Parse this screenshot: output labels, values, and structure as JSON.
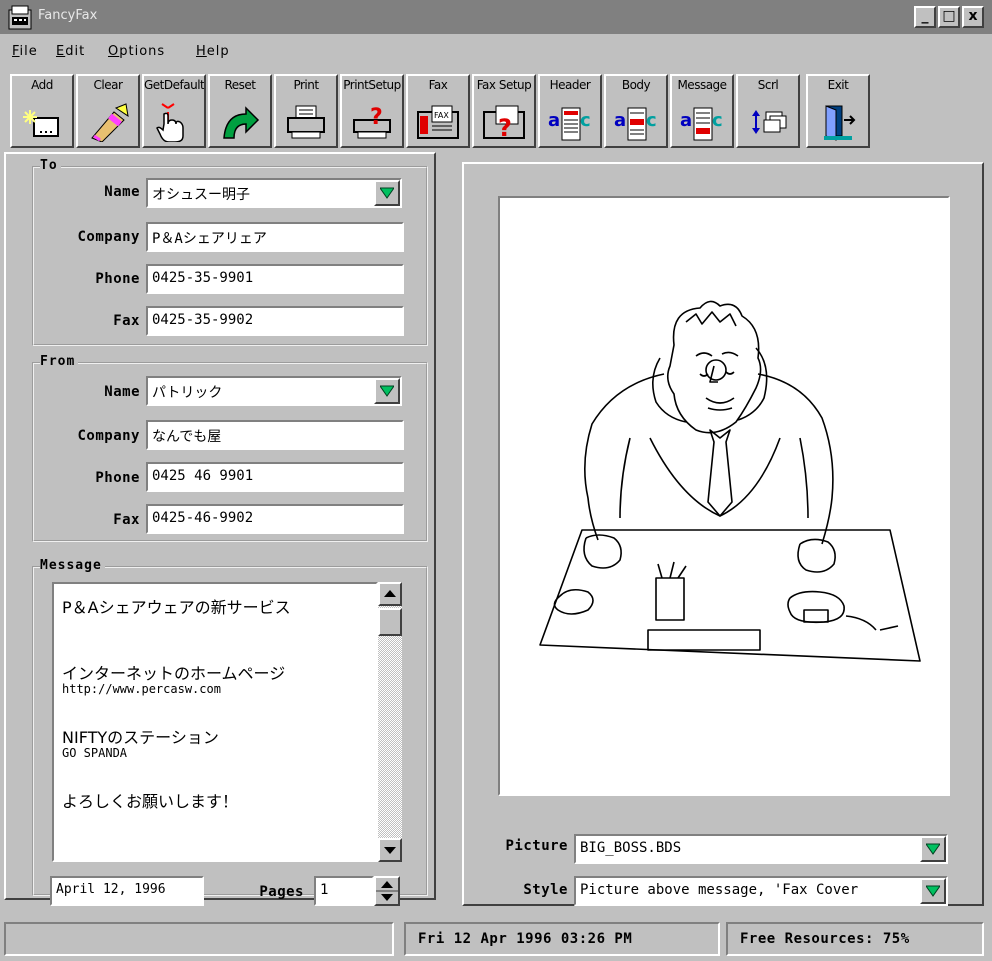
{
  "window": {
    "title": "FancyFax",
    "min_label": "_",
    "max_label": "□",
    "close_label": "x"
  },
  "menu": {
    "items": [
      "File",
      "Edit",
      "Options",
      "Help"
    ]
  },
  "toolbar": {
    "buttons": [
      {
        "label": "Add",
        "icon": "add-page-icon"
      },
      {
        "label": "Clear",
        "icon": "eraser-icon"
      },
      {
        "label": "GetDefault",
        "icon": "hand-ribbon-icon"
      },
      {
        "label": "Reset",
        "icon": "reset-arrow-icon"
      },
      {
        "label": "Print",
        "icon": "printer-icon"
      },
      {
        "label": "PrintSetup",
        "icon": "print-setup-icon"
      },
      {
        "label": "Fax",
        "icon": "fax-icon"
      },
      {
        "label": "Fax Setup",
        "icon": "fax-setup-icon"
      },
      {
        "label": "Header",
        "icon": "abc-header-icon"
      },
      {
        "label": "Body",
        "icon": "abc-body-icon"
      },
      {
        "label": "Message",
        "icon": "abc-message-icon"
      },
      {
        "label": "Scrl",
        "icon": "scroll-icon"
      },
      {
        "label": "Exit",
        "icon": "exit-door-icon"
      }
    ]
  },
  "to": {
    "legend": "To",
    "name_label": "Name",
    "name": "オシュスー明子",
    "company_label": "Company",
    "company": "P＆Aシェアリェア",
    "phone_label": "Phone",
    "phone": "0425-35-9901",
    "fax_label": "Fax",
    "fax": "0425-35-9902"
  },
  "from": {
    "legend": "From",
    "name_label": "Name",
    "name": "パトリック",
    "company_label": "Company",
    "company": "なんでも屋",
    "phone_label": "Phone",
    "phone": "0425 46 9901",
    "fax_label": "Fax",
    "fax": "0425-46-9902"
  },
  "message": {
    "legend": "Message",
    "lines": [
      {
        "text": "P＆Aシェアウェアの新サービス",
        "small": false
      },
      {
        "text": "",
        "small": false
      },
      {
        "text": "",
        "small": false
      },
      {
        "text": "インターネットのホームページ",
        "small": false
      },
      {
        "text": "http://www.percasw.com",
        "small": true
      },
      {
        "text": "",
        "small": false
      },
      {
        "text": "NIFTYのステーション",
        "small": false
      },
      {
        "text": "GO SPANDA",
        "small": true
      },
      {
        "text": "",
        "small": false
      },
      {
        "text": " よろしくお願いします！",
        "small": false
      }
    ],
    "date": "April 12, 1996",
    "pages_label": "Pages",
    "pages": "1"
  },
  "preview": {
    "picture_label": "Picture",
    "picture": "BIG_BOSS.BDS",
    "style_label": "Style",
    "style": "Picture above message, 'Fax Cover"
  },
  "status": {
    "left": "",
    "datetime": "Fri 12 Apr 1996 03:26 PM",
    "resources": "Free Resources:  75%"
  }
}
